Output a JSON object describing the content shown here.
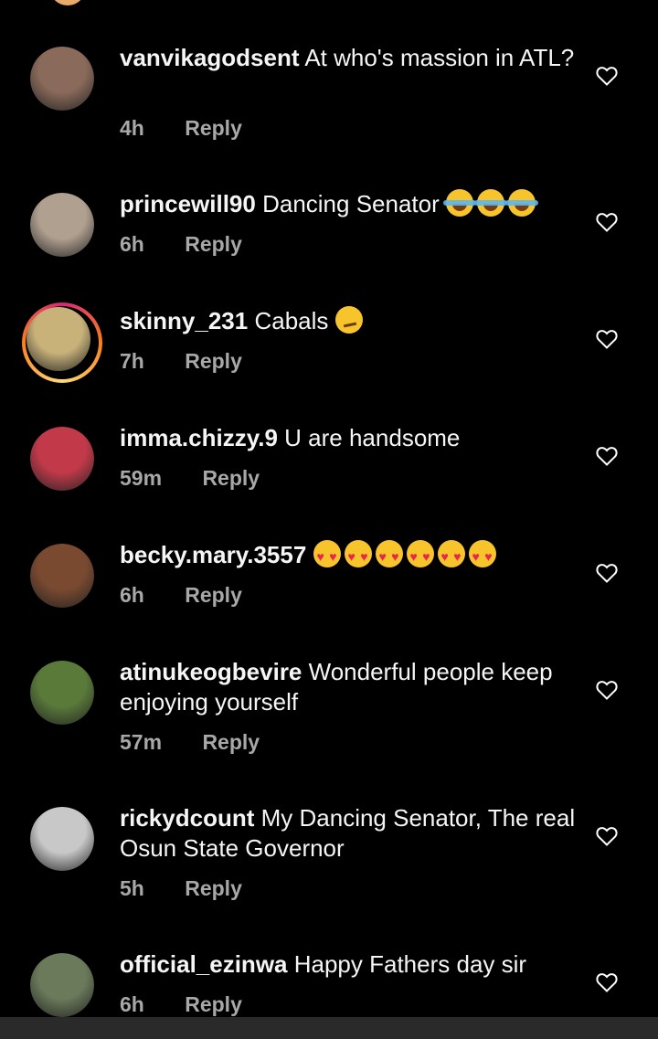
{
  "comments": [
    {
      "username": "vanvikagodsent",
      "text": "At who's massion in ATL?",
      "time": "4h",
      "reply": "Reply",
      "avatar_color": "#8a6a5a"
    },
    {
      "username": "princewill90",
      "text": "Dancing Senator",
      "emojis": [
        "laugh",
        "laugh",
        "laugh"
      ],
      "time": "6h",
      "reply": "Reply",
      "avatar_color": "#b0a090"
    },
    {
      "username": "skinny_231",
      "text": "Cabals",
      "emojis": [
        "smirk"
      ],
      "time": "7h",
      "reply": "Reply",
      "avatar_color": "#c9b27a",
      "story_ring": true
    },
    {
      "username": "imma.chizzy.9",
      "text": "U are handsome",
      "time": "59m",
      "reply": "Reply",
      "avatar_color": "#c23a4a"
    },
    {
      "username": "becky.mary.3557",
      "text": "",
      "emojis": [
        "heart-eyes",
        "heart-eyes",
        "heart-eyes",
        "heart-eyes",
        "heart-eyes",
        "heart-eyes"
      ],
      "time": "6h",
      "reply": "Reply",
      "avatar_color": "#7a4a30"
    },
    {
      "username": "atinukeogbevire",
      "text": "Wonderful people keep enjoying yourself",
      "time": "57m",
      "reply": "Reply",
      "avatar_color": "#5a7a3a"
    },
    {
      "username": "rickydcount",
      "text": "My Dancing Senator, The real Osun State Governor",
      "time": "5h",
      "reply": "Reply",
      "avatar_color": "#c8c8c8"
    },
    {
      "username": "official_ezinwa",
      "text": "Happy Fathers day sir",
      "time": "6h",
      "reply": "Reply",
      "avatar_color": "#6a7a5a"
    }
  ],
  "colors": {
    "background": "#000000",
    "text": "#f5f5f5",
    "meta": "#a8a8a8"
  }
}
